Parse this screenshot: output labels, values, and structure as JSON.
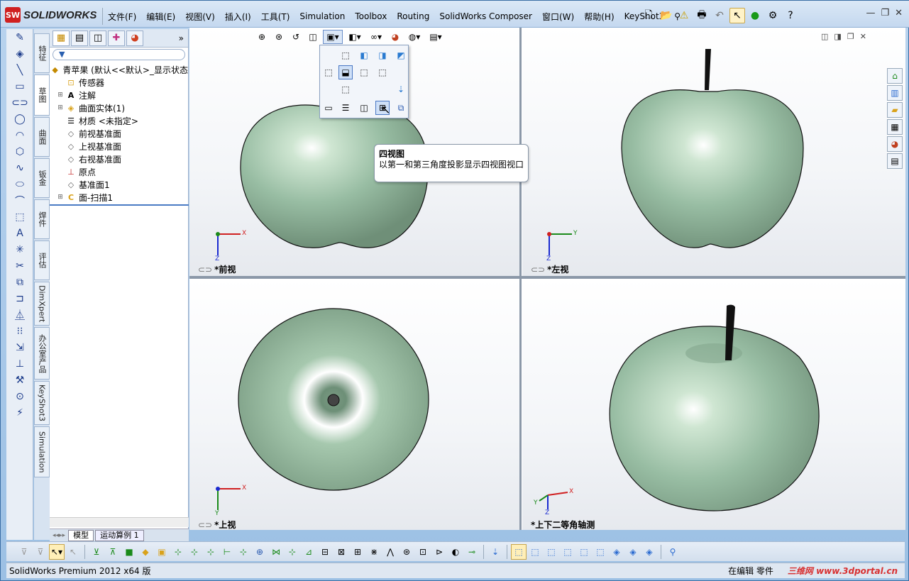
{
  "app": {
    "logo_text": "SOLIDWORKS",
    "logo_mark": "SW",
    "menus": [
      "文件(F)",
      "编辑(E)",
      "视图(V)",
      "插入(I)",
      "工具(T)",
      "Simulation",
      "Toolbox",
      "Routing",
      "SolidWorks Composer",
      "窗口(W)",
      "帮助(H)",
      "KeyShot3"
    ]
  },
  "vertical_tabs": [
    "特征",
    "草图",
    "曲面",
    "钣金",
    "焊件",
    "评估",
    "DimXpert",
    "办公室产品",
    "KeyShot3",
    "Simulation"
  ],
  "feature_tree": {
    "root": "青苹果 (默认<<默认>_显示状态",
    "items": [
      {
        "label": "传感器",
        "icon": "sensor-icon",
        "expandable": false
      },
      {
        "label": "注解",
        "icon": "annotation-icon",
        "expandable": true
      },
      {
        "label": "曲面实体(1)",
        "icon": "surface-body-icon",
        "expandable": true
      },
      {
        "label": "材质 <未指定>",
        "icon": "material-icon",
        "expandable": false
      },
      {
        "label": "前视基准面",
        "icon": "plane-icon",
        "expandable": false
      },
      {
        "label": "上视基准面",
        "icon": "plane-icon",
        "expandable": false
      },
      {
        "label": "右视基准面",
        "icon": "plane-icon",
        "expandable": false
      },
      {
        "label": "原点",
        "icon": "origin-icon",
        "expandable": false
      },
      {
        "label": "基准面1",
        "icon": "plane-icon",
        "expandable": false
      },
      {
        "label": "面-扫描1",
        "icon": "sweep-icon",
        "expandable": true
      }
    ],
    "bottom_tabs": [
      "模型",
      "运动算例 1"
    ]
  },
  "views": [
    {
      "label": "*前视",
      "axis_a": "X",
      "axis_b": "Z"
    },
    {
      "label": "*左视",
      "axis_a": "Y",
      "axis_b": "Z"
    },
    {
      "label": "*上视",
      "axis_a": "X",
      "axis_b": "Y"
    },
    {
      "label": "*上下二等角轴测",
      "axis_a": "X",
      "axis_b": "Z",
      "axis_c": "Y"
    }
  ],
  "tooltip": {
    "title": "四视图",
    "description": "以第一和第三角度投影显示四视图视口"
  },
  "status": {
    "left": "SolidWorks Premium 2012 x64 版",
    "editing": "在编辑 零件",
    "watermark": "三维网 www.3dportal.cn"
  },
  "colors": {
    "apple": "#9fc2a8",
    "accent": "#4a7bc4"
  }
}
